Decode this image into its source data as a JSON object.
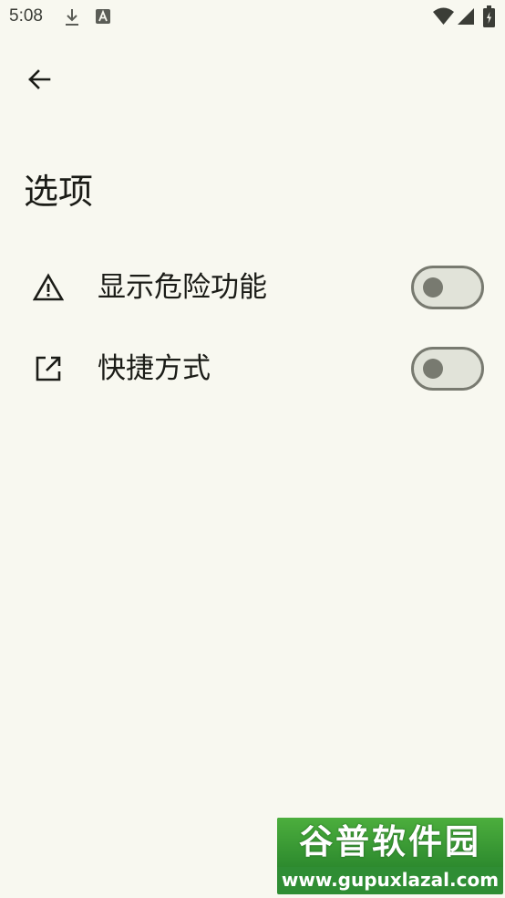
{
  "status_bar": {
    "time": "5:08",
    "icons": [
      "download-icon",
      "a-notification-icon",
      "wifi-icon",
      "signal-icon",
      "battery-icon"
    ]
  },
  "header": {
    "back_icon": "arrow-left-icon",
    "title": "选项"
  },
  "settings": [
    {
      "icon": "warning-icon",
      "label": "显示危险功能",
      "enabled": false
    },
    {
      "icon": "open-in-new-icon",
      "label": "快捷方式",
      "enabled": false
    }
  ],
  "watermark": {
    "brand": "谷普软件园",
    "url": "www.gupuxlazal.com"
  },
  "colors": {
    "background": "#f8f8f0",
    "text": "#1b1c17",
    "switch_track": "#e1e3d9",
    "switch_outline": "#787a70",
    "watermark_green": "#2f8d34"
  }
}
